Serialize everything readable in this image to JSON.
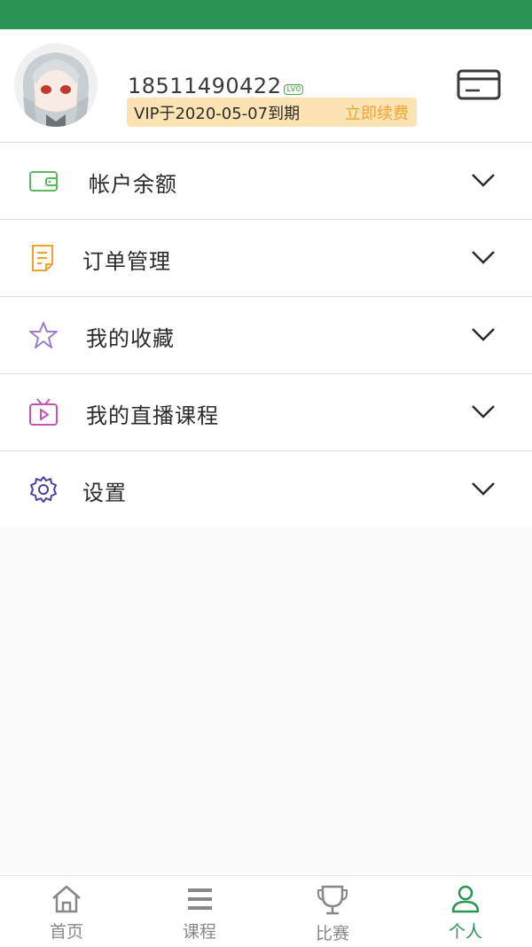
{
  "profile": {
    "phone": "18511490422",
    "level": "LV0",
    "vip_text": "VIP于2020-05-07到期",
    "renew_label": "立即续费"
  },
  "menu": [
    {
      "label": "帐户余额",
      "icon": "wallet-icon",
      "color": "#5cb85c"
    },
    {
      "label": "订单管理",
      "icon": "order-list-icon",
      "color": "#f0a331"
    },
    {
      "label": "我的收藏",
      "icon": "star-icon",
      "color": "#9a7bd6"
    },
    {
      "label": "我的直播课程",
      "icon": "tv-play-icon",
      "color": "#c455b5"
    },
    {
      "label": "设置",
      "icon": "gear-icon",
      "color": "#4a3fa0"
    }
  ],
  "tabs": [
    {
      "label": "首页",
      "icon": "home-icon",
      "active": false
    },
    {
      "label": "课程",
      "icon": "menu-lines-icon",
      "active": false
    },
    {
      "label": "比赛",
      "icon": "trophy-icon",
      "active": false
    },
    {
      "label": "个人",
      "icon": "person-icon",
      "active": true
    }
  ],
  "colors": {
    "brand_green": "#2b9455",
    "vip_bg": "#fbe3b3",
    "renew": "#f0a331"
  }
}
